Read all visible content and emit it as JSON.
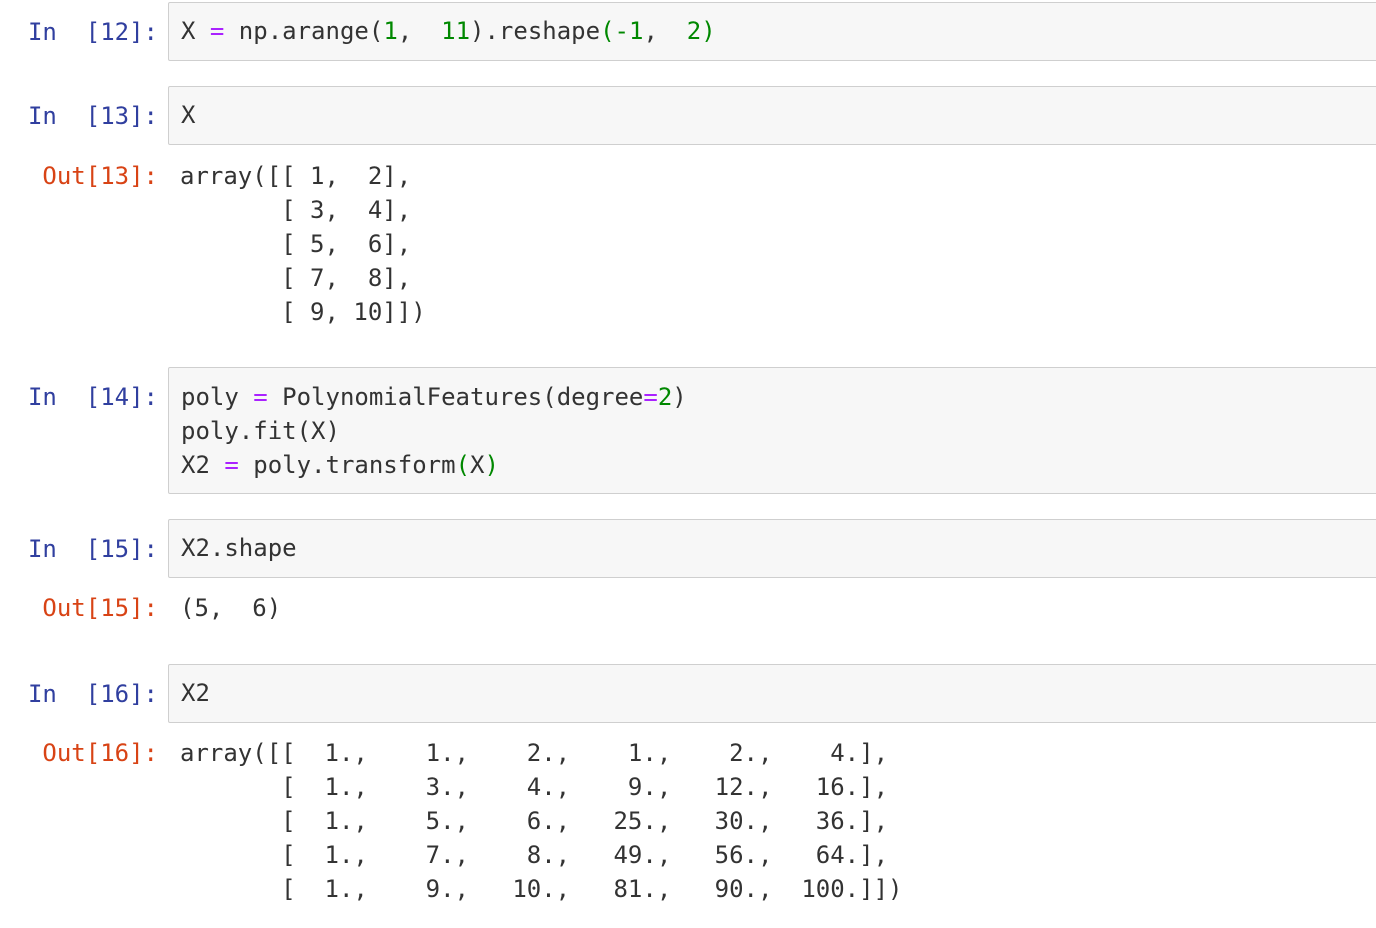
{
  "cells": [
    {
      "in_prompt": "In  [12]:",
      "code": {
        "var": "X ",
        "op": "=",
        "mid": " np.arange(",
        "n1": "1",
        "sep1": ",  ",
        "n2": "11",
        "mid2": ").reshape",
        "lp": "(",
        "n3": "-1",
        "sep2": ",  ",
        "n4": "2",
        "rp": ")"
      }
    },
    {
      "in_prompt": "In  [13]:",
      "code_text": "X",
      "out_prompt": "Out[13]:",
      "output_text": "array([[ 1,  2],\n       [ 3,  4],\n       [ 5,  6],\n       [ 7,  8],\n       [ 9, 10]])"
    },
    {
      "in_prompt": "In  [14]:",
      "line1": {
        "a": "poly ",
        "op": "=",
        "b": " PolynomialFeatures(degree",
        "op2": "=",
        "n": "2",
        "c": ")"
      },
      "line2": "poly.fit(X)",
      "line3": {
        "a": "X2 ",
        "op": "=",
        "b": " poly.transform",
        "lp": "(",
        "arg": "X",
        "rp": ")"
      }
    },
    {
      "in_prompt": "In  [15]:",
      "code_text": "X2.shape",
      "out_prompt": "Out[15]:",
      "output_text": "(5,  6)"
    },
    {
      "in_prompt": "In  [16]:",
      "code_text": "X2",
      "out_prompt": "Out[16]:",
      "output_text": "array([[  1.,    1.,    2.,    1.,    2.,    4.],\n       [  1.,    3.,    4.,    9.,   12.,   16.],\n       [  1.,    5.,    6.,   25.,   30.,   36.],\n       [  1.,    7.,    8.,   49.,   56.,   64.],\n       [  1.,    9.,   10.,   81.,   90.,  100.]])"
    }
  ],
  "colors": {
    "in_prompt": "#303f9f",
    "out_prompt": "#d84315",
    "operator": "#aa22ff",
    "number": "#008800",
    "cell_bg": "#f7f7f7",
    "cell_border": "#cfcfcf"
  }
}
